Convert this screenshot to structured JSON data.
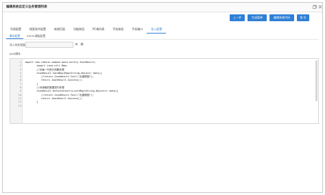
{
  "window": {
    "title": "编辑系统自定义业务管理列表",
    "restore_icon": "restore-icon",
    "close_icon": "close-icon"
  },
  "toolbar": {
    "buttons": [
      {
        "label": "上一步"
      },
      {
        "label": "生成菜单"
      },
      {
        "label": "编辑系统代码"
      },
      {
        "label": "保 存"
      }
    ]
  },
  "tabs": [
    {
      "label": "列表配置"
    },
    {
      "label": "搜索条件配置"
    },
    {
      "label": "新增页面"
    },
    {
      "label": "功能按钮"
    },
    {
      "label": "PC端列表"
    },
    {
      "label": "手机按钮"
    },
    {
      "label": "手机端口"
    },
    {
      "label": "导入配置"
    }
  ],
  "active_tab": "导入配置",
  "subtabs": [
    {
      "label": "脚本配置"
    },
    {
      "label": "EXCEL模板配置"
    }
  ],
  "form": {
    "label": "导入的处理器",
    "value": "",
    "clear_icon": "clear-icon",
    "settings_icon": "gear-icon"
  },
  "section": {
    "label": "JAVA脚本"
  },
  "editor": {
    "lines": [
      "import com.redsun.common.base.entity.JsonResult;",
      "        import java.util.Map;",
      "        //对每一行进行判断处理",
      "        JsonResult handRow(Map<String,Object> data){",
      "           //return JsonResult.Fail(\"出错原因\");",
      "           return JsonResult.Success();",
      "        }",
      "        //对读取的数据进行处理",
      "        JsonResult beforeInsert(List<Map<String,Object>> data){",
      "           //return JsonResult.Fail(\"出错原因\");",
      "           return JsonResult.Success();",
      "        }",
      ""
    ]
  }
}
